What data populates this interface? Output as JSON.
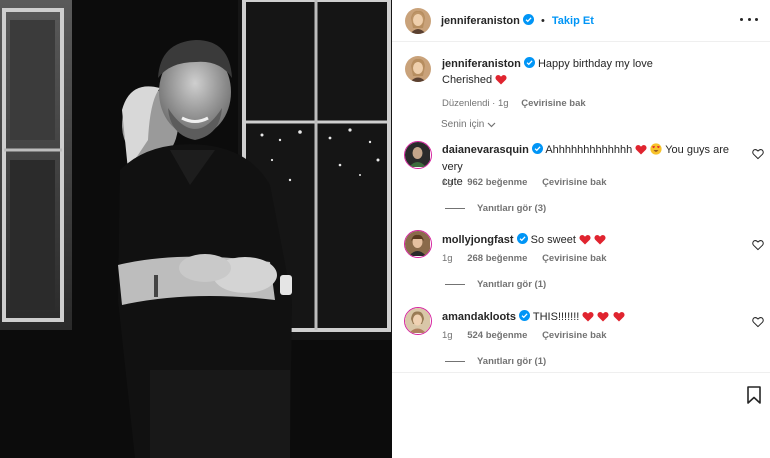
{
  "post_author": {
    "username": "jenniferaniston",
    "follow_label": "Takip Et",
    "separator": "•"
  },
  "caption": {
    "username": "jenniferaniston",
    "text_line1": "Happy birthday my love",
    "text_line2": "Cherished",
    "edited": "Düzenlendi",
    "age": "1g",
    "translate": "Çevirisine bak"
  },
  "sort_filter": {
    "label": "Senin için"
  },
  "comments": [
    {
      "username": "daianevarasquin",
      "text_a": "Ahhhhhhhhhhhhh",
      "text_b": "You guys are very",
      "text_c": "cute",
      "age": "1g",
      "likes": "962 beğenme",
      "translate": "Çevirisine bak",
      "replies": "Yanıtları gör (3)"
    },
    {
      "username": "mollyjongfast",
      "text_a": "So sweet",
      "age": "1g",
      "likes": "268 beğenme",
      "translate": "Çevirisine bak",
      "replies": "Yanıtları gör (1)"
    },
    {
      "username": "amandakloots",
      "text_a": "THIS!!!!!!!",
      "age": "1g",
      "likes": "524 beğenme",
      "translate": "Çevirisine bak",
      "replies": "Yanıtları gör (1)"
    }
  ],
  "colors": {
    "accent": "#0095f6",
    "verified": "#0095f6",
    "heart": "#e0242f",
    "muted": "#737373",
    "text": "#262626"
  },
  "icons": {
    "more": "more-options-icon",
    "bookmark": "bookmark-icon",
    "like": "heart-outline-icon",
    "verified": "verified-badge-icon"
  }
}
